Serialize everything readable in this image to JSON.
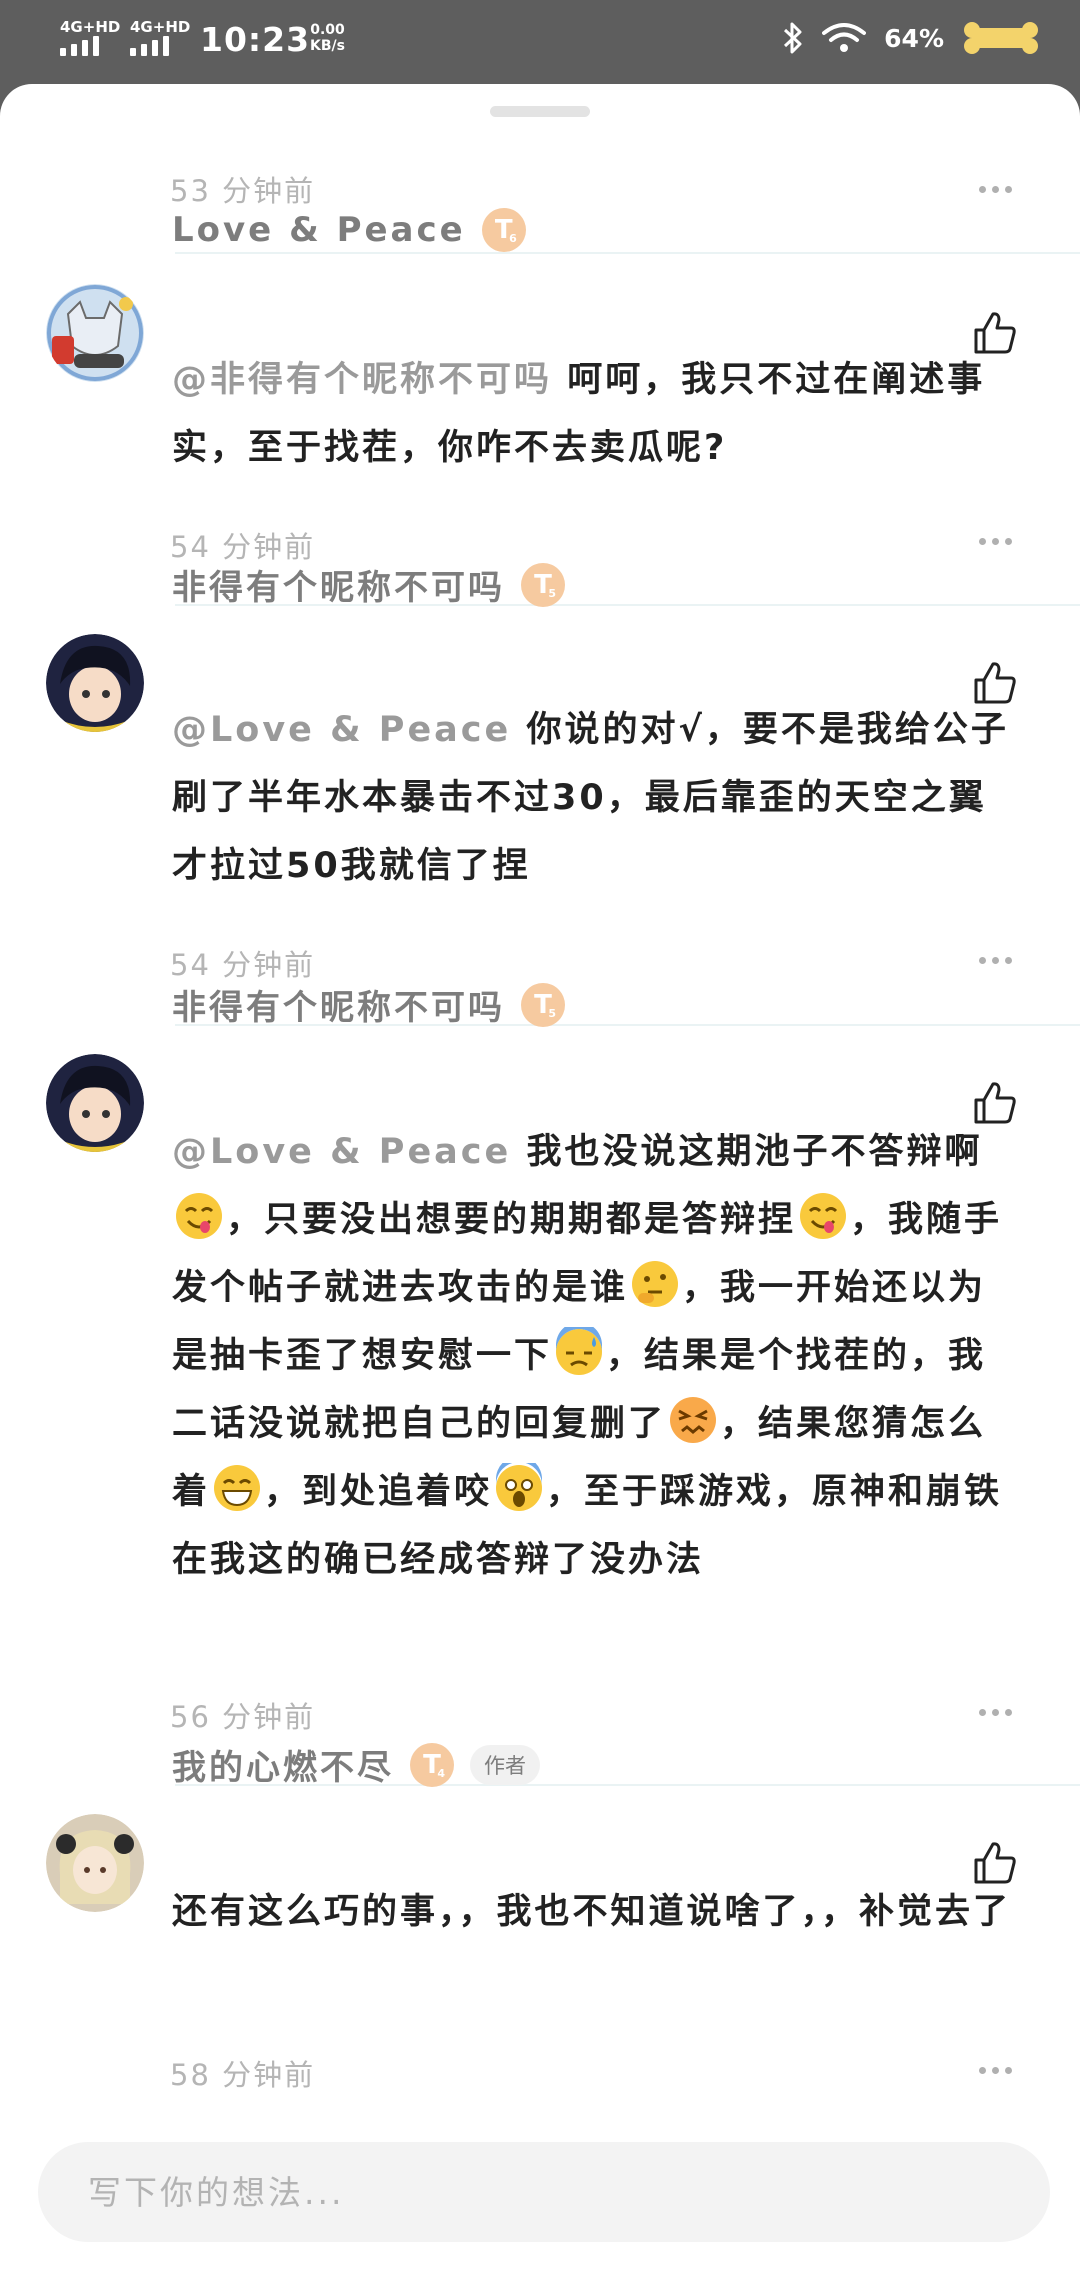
{
  "status_bar": {
    "network1": "4G+HD",
    "network2": "4G+HD",
    "time": "10:23",
    "speed_value": "0.00",
    "speed_unit": "KB/s",
    "battery": "64%"
  },
  "comments": [
    {
      "id": "c0",
      "time": "53 分钟前"
    },
    {
      "id": "c1",
      "name": "Love & Peace",
      "level": "T",
      "level_num": "6",
      "mention": "@非得有个昵称不可吗",
      "text": "呵呵，我只不过在阐述事实，至于找茬，你咋不去卖瓜呢?",
      "time": "54 分钟前"
    },
    {
      "id": "c2",
      "name": "非得有个昵称不可吗",
      "level": "T",
      "level_num": "5",
      "mention": "@Love & Peace",
      "text": "你说的对√，要不是我给公子刷了半年水本暴击不过30，最后靠歪的天空之翼才拉过50我就信了捏",
      "time": "54 分钟前"
    },
    {
      "id": "c3",
      "name": "非得有个昵称不可吗",
      "level": "T",
      "level_num": "5",
      "mention": "@Love & Peace",
      "segments": [
        "我也没说这期池子不答辩啊",
        "，只要没出想要的期期都是答辩捏",
        "，我随手发个帖子就进去攻击的是谁",
        "，我一开始还以为是抽卡歪了想安慰一下",
        "，结果是个找茬的，我二话没说就把自己的回复删了",
        "，结果您猜怎么着",
        "，到处追着咬",
        "，至于踩游戏，原神和崩铁在我这的确已经成答辩了没办法"
      ],
      "time": "56 分钟前"
    },
    {
      "id": "c4",
      "name": "我的心燃不尽",
      "level": "T",
      "level_num": "4",
      "author_tag": "作者",
      "text": "还有这么巧的事，，我也不知道说啥了，，补觉去了",
      "time": "58 分钟前"
    }
  ],
  "input": {
    "placeholder": "写下你的想法..."
  },
  "colors": {
    "accent_level": "#f6caa0",
    "meta_text": "#b5b5b5",
    "body_text": "#222222"
  }
}
